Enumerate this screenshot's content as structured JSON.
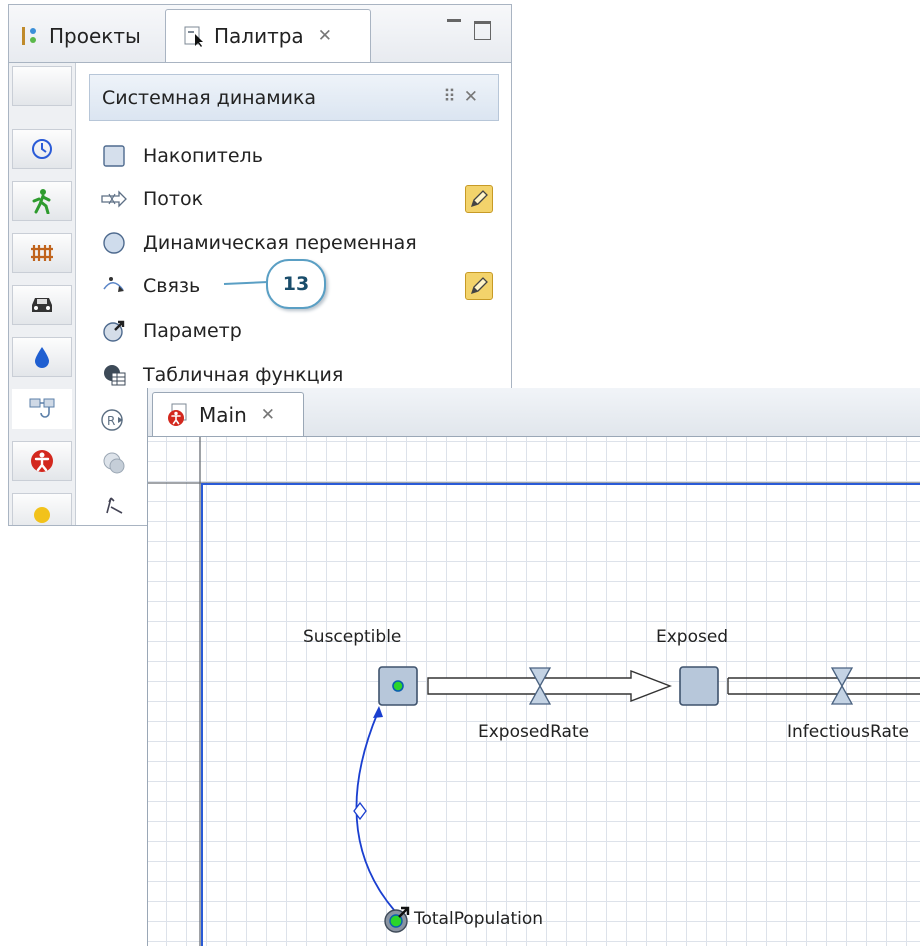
{
  "palette_view": {
    "tabs": [
      {
        "label": "Проекты",
        "icon": "projects-icon"
      },
      {
        "label": "Палитра",
        "icon": "palette-icon"
      }
    ],
    "categories": [
      "sd-clock-icon",
      "pedestrian-icon",
      "rail-icon",
      "car-icon",
      "fluid-drop-icon",
      "sd-flow-icon",
      "person-icon",
      "light-bulb-icon"
    ],
    "section_title": "Системная динамика",
    "items": [
      {
        "label": "Накопитель",
        "icon": "stock-icon",
        "editable": false
      },
      {
        "label": "Поток",
        "icon": "flow-icon",
        "editable": true
      },
      {
        "label": "Динамическая переменная",
        "icon": "dynamic-variable-icon",
        "editable": false
      },
      {
        "label": "Связь",
        "icon": "link-icon",
        "editable": true
      },
      {
        "label": "Параметр",
        "icon": "parameter-icon",
        "editable": false
      },
      {
        "label": "Табличная функция",
        "icon": "table-function-icon",
        "editable": false
      }
    ]
  },
  "callout": {
    "number": "13"
  },
  "editor": {
    "tab_label": "Main",
    "diagram": {
      "stock_susceptible": "Susceptible",
      "stock_exposed": "Exposed",
      "flow_exposed_rate": "ExposedRate",
      "flow_infectious_rate": "InfectiousRate",
      "parameter_total_population": "TotalPopulation"
    }
  },
  "colors": {
    "accent": "#2a5bd7",
    "link": "#1a3fd0",
    "callout_border": "#5a9fc4",
    "pencil": "#f3d36b"
  }
}
